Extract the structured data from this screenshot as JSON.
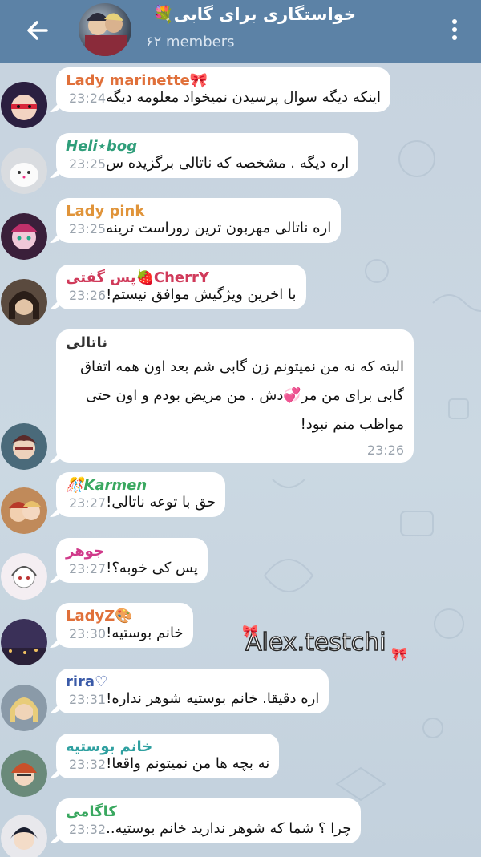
{
  "header": {
    "title": "خواستگاری برای گابی💐",
    "subtitle": "۶۲ members"
  },
  "messages": [
    {
      "sender": "Lady marinette🎀",
      "color": "#e0703a",
      "text": "اینکه دیگه سوال پرسیدن نمیخواد معلومه دیگه",
      "time": "23:24"
    },
    {
      "sender": "Heli⋆bog",
      "color": "#2f9e7a",
      "text": "اره دیگه . مشخصه که ناتالی برگزیده س",
      "time": "23:25"
    },
    {
      "sender": "Lady pink",
      "color": "#e0943a",
      "text": "اره ناتالی مهربون ترین روراست ترینه",
      "time": "23:25"
    },
    {
      "sender": "پس گفتی🍓CherrY",
      "color": "#d03a5a",
      "text": "با اخرین ویژگیش موافق نیستم!",
      "time": "23:26"
    },
    {
      "sender": "ناتالی",
      "color": "#333333",
      "text": "البته که نه من نمیتونم زن گابی شم بعد اون همه اتفاق گابی برای من مر💞دش . من مریض بودم و اون حتی مواظب منم نبود!",
      "time": "23:26"
    },
    {
      "sender": "🎊Karmen",
      "color": "#3aa860",
      "text": "حق با توعه ناتالی!",
      "time": "23:27"
    },
    {
      "sender": "جوهر",
      "color": "#d03a8a",
      "text": "پس کی خوبه؟!",
      "time": "23:27"
    },
    {
      "sender": "LadyZ🎨",
      "color": "#e0703a",
      "text": "خانم بوستیه!",
      "time": "23:30"
    },
    {
      "sender": "rira♡",
      "color": "#3a5aa8",
      "text": "اره دقیقا. خانم بوستیه شوهر نداره!",
      "time": "23:31"
    },
    {
      "sender": "خانم بوستیه",
      "color": "#2fa0a0",
      "text": "نه بچه ها من نمیتونم واقعا!",
      "time": "23:32"
    },
    {
      "sender": "کاگامی",
      "color": "#3aa860",
      "text": "چرا ؟ شما که شوهر ندارید خانم بوستیه..",
      "time": "23:32"
    }
  ],
  "watermark": "Alex.testchi",
  "avatars": [
    "red-mask-avatar",
    "white-cat-avatar",
    "pink-hero-avatar",
    "dark-hair-avatar",
    "natalie-avatar",
    "karmen-avatar",
    "sketch-girl-avatar",
    "city-night-avatar",
    "blonde-girl-avatar",
    "redhead-teacher-avatar",
    "kagami-avatar"
  ]
}
